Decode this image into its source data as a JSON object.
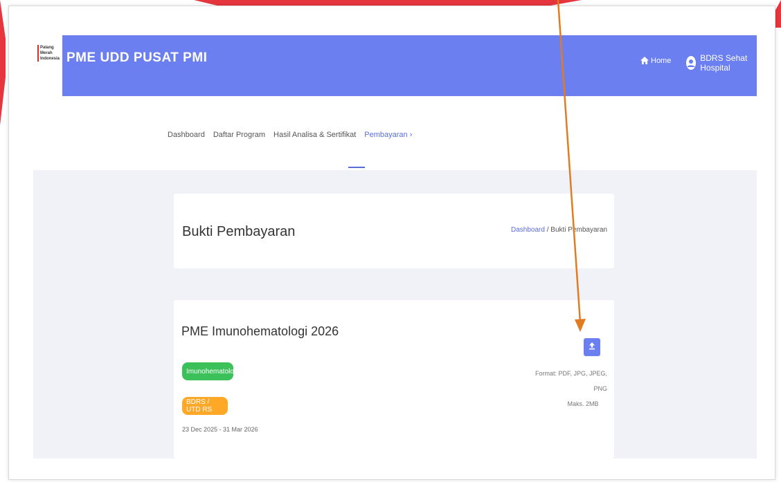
{
  "header": {
    "logo_text": "Palang\nMerah\nIndonesia",
    "brand": "PME UDD PUSAT PMI",
    "home_label": "Home",
    "user_name": "BDRS Sehat Hospital"
  },
  "menu": {
    "items": [
      "Dashboard",
      "Daftar Program",
      "Hasil Analisa & Sertifikat",
      "Pembayaran"
    ],
    "active_index": 3
  },
  "page": {
    "title": "Bukti Pembayaran",
    "breadcrumb": {
      "link": "Dashboard",
      "separator": "/",
      "current": "Bukti Pembayaran"
    }
  },
  "program": {
    "title": "PME Imunohematologi 2026",
    "badges": [
      "Imunohematologi",
      "BDRS / UTD RS"
    ],
    "date_range": "23 Dec 2025 - 31 Mar 2026",
    "upload_format": "Format: PDF, JPG, JPEG, PNG",
    "upload_max": "Maks. 2MB"
  },
  "colors": {
    "primary": "#6b7ff0",
    "badge_green": "#3cc15a",
    "badge_orange": "#ffa726",
    "annotation_arrow": "#e07b22",
    "frame_red": "#e6353d"
  }
}
